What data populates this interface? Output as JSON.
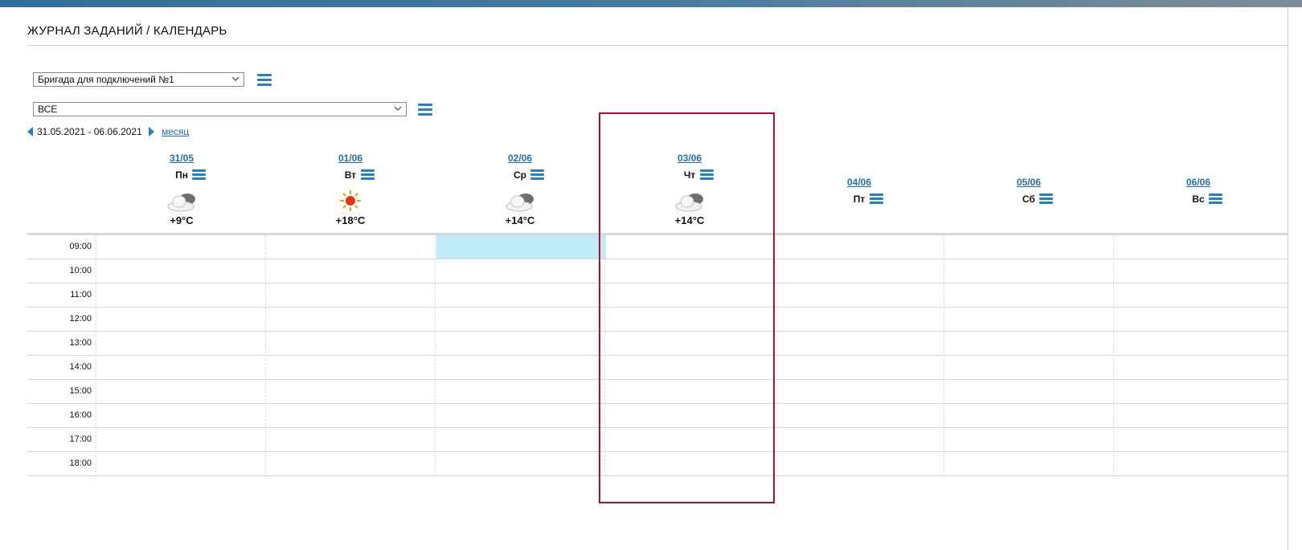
{
  "page": {
    "title": "ЖУРНАЛ ЗАДАНИЙ / КАЛЕНДАРЬ"
  },
  "filters": {
    "brigade": {
      "value": "Бригада для подключений №1",
      "icon": "chevron-down-icon"
    },
    "type": {
      "value": "ВСЕ",
      "icon": "chevron-down-icon"
    },
    "menu_icon": "hamburger-menu-icon"
  },
  "nav": {
    "range": "31.05.2021 - 06.06.2021",
    "month_link": "месяц"
  },
  "days": [
    {
      "date": "31/05",
      "name": "Пн",
      "weather": "cloudy",
      "temp": "+9°C"
    },
    {
      "date": "01/06",
      "name": "Вт",
      "weather": "sunny",
      "temp": "+18°C"
    },
    {
      "date": "02/06",
      "name": "Ср",
      "weather": "cloudy",
      "temp": "+14°C"
    },
    {
      "date": "03/06",
      "name": "Чт",
      "weather": "cloudy",
      "temp": "+14°C"
    },
    {
      "date": "04/06",
      "name": "Пт"
    },
    {
      "date": "05/06",
      "name": "Сб"
    },
    {
      "date": "06/06",
      "name": "Вс"
    }
  ],
  "hours": [
    "09:00",
    "10:00",
    "11:00",
    "12:00",
    "13:00",
    "14:00",
    "15:00",
    "16:00",
    "17:00",
    "18:00"
  ],
  "colors": {
    "accent": "#1f7fd0",
    "link": "#1f6fb5",
    "highlight": "#bfeaf8",
    "frame": "#b0102a"
  }
}
